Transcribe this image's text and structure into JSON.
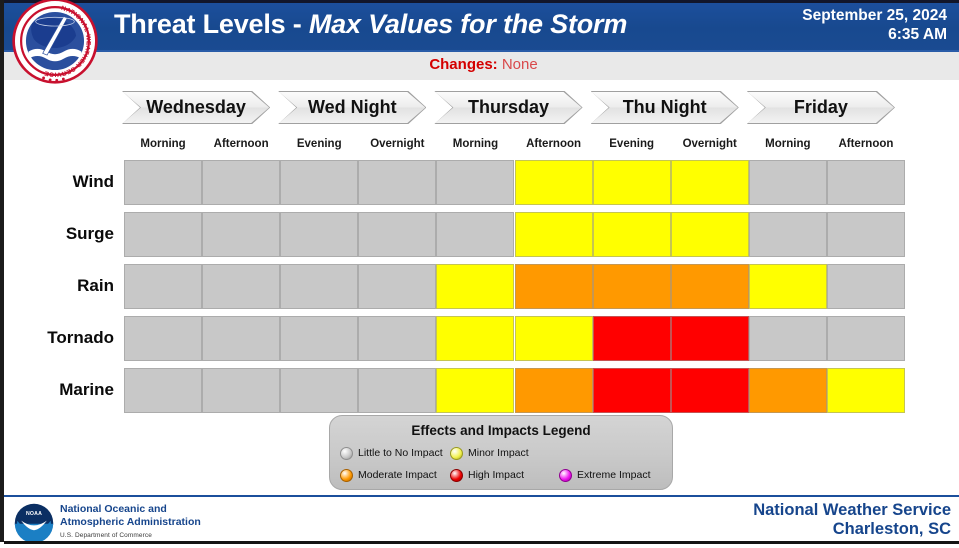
{
  "header": {
    "title_plain": "Threat Levels - ",
    "title_italic": "Max Values for the Storm",
    "date": "September 25, 2024",
    "time": "6:35 AM",
    "logo_name": "national-weather-service-seal",
    "bg_color": "#1a4b92"
  },
  "changes": {
    "label": "Changes:",
    "value": "None",
    "color": "#d40000"
  },
  "days": [
    {
      "label": "Wednesday"
    },
    {
      "label": "Wed Night"
    },
    {
      "label": "Thursday"
    },
    {
      "label": "Thu Night"
    },
    {
      "label": "Friday"
    }
  ],
  "periods": [
    "Morning",
    "Afternoon",
    "Evening",
    "Overnight",
    "Morning",
    "Afternoon",
    "Evening",
    "Overnight",
    "Morning",
    "Afternoon"
  ],
  "threat_colors": {
    "none": "#c8c8c8",
    "minor": "#ffff00",
    "moderate": "#ff9900",
    "high": "#ff0000",
    "extreme": "#ff00ff"
  },
  "chart_data": {
    "type": "heatmap",
    "title": "Threat Levels - Max Values for the Storm",
    "xlabel": "",
    "ylabel": "",
    "grid": true,
    "legend_position": "bottom-center",
    "x": [
      "Wednesday Morning",
      "Wednesday Afternoon",
      "Wed Night Evening",
      "Wed Night Overnight",
      "Thursday Morning",
      "Thursday Afternoon",
      "Thu Night Evening",
      "Thu Night Overnight",
      "Friday Morning",
      "Friday Afternoon"
    ],
    "categories": [
      "Wind",
      "Surge",
      "Rain",
      "Tornado",
      "Marine"
    ],
    "levels": [
      "none",
      "minor",
      "moderate",
      "high",
      "extreme"
    ],
    "level_values": {
      "none": 0,
      "minor": 1,
      "moderate": 2,
      "high": 3,
      "extreme": 4
    },
    "series": [
      {
        "name": "Wind",
        "values": [
          "none",
          "none",
          "none",
          "none",
          "none",
          "minor",
          "minor",
          "minor",
          "none",
          "none"
        ]
      },
      {
        "name": "Surge",
        "values": [
          "none",
          "none",
          "none",
          "none",
          "none",
          "minor",
          "minor",
          "minor",
          "none",
          "none"
        ]
      },
      {
        "name": "Rain",
        "values": [
          "none",
          "none",
          "none",
          "none",
          "minor",
          "moderate",
          "moderate",
          "moderate",
          "minor",
          "none"
        ]
      },
      {
        "name": "Tornado",
        "values": [
          "none",
          "none",
          "none",
          "none",
          "minor",
          "minor",
          "high",
          "high",
          "none",
          "none"
        ]
      },
      {
        "name": "Marine",
        "values": [
          "none",
          "none",
          "none",
          "none",
          "minor",
          "moderate",
          "high",
          "high",
          "moderate",
          "minor"
        ]
      }
    ]
  },
  "legend": {
    "title": "Effects and Impacts Legend",
    "items": [
      {
        "label": "Little to No Impact",
        "color": "#c8c8c8",
        "edge": "#8f8f8f"
      },
      {
        "label": "Minor Impact",
        "color": "#f2f24d",
        "edge": "#9a9a20"
      },
      {
        "label": "Moderate Impact",
        "color": "#ff9900",
        "edge": "#a86000"
      },
      {
        "label": "High Impact",
        "color": "#ee0000",
        "edge": "#8c0000"
      },
      {
        "label": "Extreme Impact",
        "color": "#f010f0",
        "edge": "#900090"
      }
    ]
  },
  "footer": {
    "noaa_logo_name": "noaa-logo",
    "noaa_line1": "National Oceanic and",
    "noaa_line2": "Atmospheric Administration",
    "noaa_line3": "U.S. Department of Commerce",
    "office_line1": "National Weather Service",
    "office_line2": "Charleston, SC"
  }
}
